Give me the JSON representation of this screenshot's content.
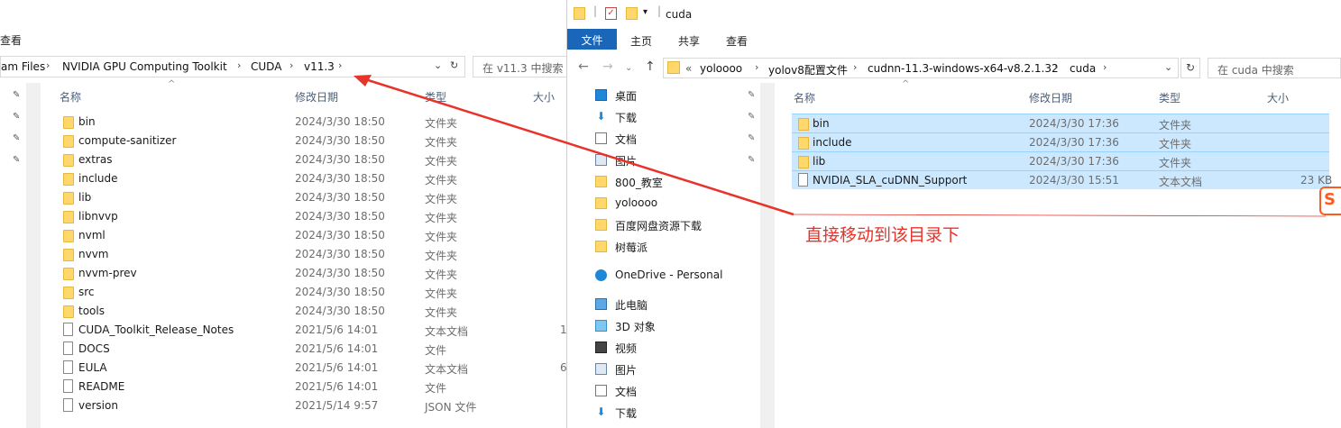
{
  "left": {
    "menu_fragment": "查看",
    "breadcrumb": [
      "am Files",
      "NVIDIA GPU Computing Toolkit",
      "CUDA",
      "v11.3"
    ],
    "search_placeholder": "在 v11.3 中搜索",
    "columns": {
      "name": "名称",
      "date": "修改日期",
      "type": "类型",
      "size": "大小"
    },
    "rows": [
      {
        "icon": "folder",
        "name": "bin",
        "date": "2024/3/30 18:50",
        "type": "文件夹",
        "size": ""
      },
      {
        "icon": "folder",
        "name": "compute-sanitizer",
        "date": "2024/3/30 18:50",
        "type": "文件夹",
        "size": ""
      },
      {
        "icon": "folder",
        "name": "extras",
        "date": "2024/3/30 18:50",
        "type": "文件夹",
        "size": ""
      },
      {
        "icon": "folder",
        "name": "include",
        "date": "2024/3/30 18:50",
        "type": "文件夹",
        "size": ""
      },
      {
        "icon": "folder",
        "name": "lib",
        "date": "2024/3/30 18:50",
        "type": "文件夹",
        "size": ""
      },
      {
        "icon": "folder",
        "name": "libnvvp",
        "date": "2024/3/30 18:50",
        "type": "文件夹",
        "size": ""
      },
      {
        "icon": "folder",
        "name": "nvml",
        "date": "2024/3/30 18:50",
        "type": "文件夹",
        "size": ""
      },
      {
        "icon": "folder",
        "name": "nvvm",
        "date": "2024/3/30 18:50",
        "type": "文件夹",
        "size": ""
      },
      {
        "icon": "folder",
        "name": "nvvm-prev",
        "date": "2024/3/30 18:50",
        "type": "文件夹",
        "size": ""
      },
      {
        "icon": "folder",
        "name": "src",
        "date": "2024/3/30 18:50",
        "type": "文件夹",
        "size": ""
      },
      {
        "icon": "folder",
        "name": "tools",
        "date": "2024/3/30 18:50",
        "type": "文件夹",
        "size": ""
      },
      {
        "icon": "doc",
        "name": "CUDA_Toolkit_Release_Notes",
        "date": "2021/5/6 14:01",
        "type": "文本文档",
        "size": "1"
      },
      {
        "icon": "doc",
        "name": "DOCS",
        "date": "2021/5/6 14:01",
        "type": "文件",
        "size": ""
      },
      {
        "icon": "doc",
        "name": "EULA",
        "date": "2021/5/6 14:01",
        "type": "文本文档",
        "size": "6"
      },
      {
        "icon": "doc",
        "name": "README",
        "date": "2021/5/6 14:01",
        "type": "文件",
        "size": ""
      },
      {
        "icon": "doc",
        "name": "version",
        "date": "2021/5/14 9:57",
        "type": "JSON 文件",
        "size": ""
      }
    ]
  },
  "right": {
    "title": "cuda",
    "ribbon": {
      "file": "文件",
      "home": "主页",
      "share": "共享",
      "view": "查看"
    },
    "breadcrumb": [
      "«",
      "yoloooo",
      "yolov8配置文件",
      "cudnn-11.3-windows-x64-v8.2.1.32",
      "cuda"
    ],
    "search_placeholder": "在 cuda 中搜索",
    "tree": [
      {
        "icon": "desktop-icon",
        "label": "桌面"
      },
      {
        "icon": "download-icon",
        "label": "下载"
      },
      {
        "icon": "document-icon",
        "label": "文档"
      },
      {
        "icon": "picture-icon",
        "label": "图片"
      },
      {
        "icon": "folder-icon",
        "label": "800_教室"
      },
      {
        "icon": "folder-icon",
        "label": "yoloooo"
      },
      {
        "icon": "folder-icon",
        "label": "百度网盘资源下载"
      },
      {
        "icon": "folder-icon",
        "label": "树莓派"
      },
      {
        "icon": "onedrive-icon",
        "label": "OneDrive - Personal"
      },
      {
        "icon": "pc-icon",
        "label": "此电脑"
      },
      {
        "icon": "3d-icon",
        "label": "3D 对象"
      },
      {
        "icon": "video-icon",
        "label": "视频"
      },
      {
        "icon": "picture-icon",
        "label": "图片"
      },
      {
        "icon": "document-icon",
        "label": "文档"
      },
      {
        "icon": "download-icon",
        "label": "下载"
      }
    ],
    "columns": {
      "name": "名称",
      "date": "修改日期",
      "type": "类型",
      "size": "大小"
    },
    "rows": [
      {
        "icon": "folder",
        "name": "bin",
        "date": "2024/3/30 17:36",
        "type": "文件夹",
        "size": ""
      },
      {
        "icon": "folder",
        "name": "include",
        "date": "2024/3/30 17:36",
        "type": "文件夹",
        "size": ""
      },
      {
        "icon": "folder",
        "name": "lib",
        "date": "2024/3/30 17:36",
        "type": "文件夹",
        "size": ""
      },
      {
        "icon": "doc",
        "name": "NVIDIA_SLA_cuDNN_Support",
        "date": "2024/3/30 15:51",
        "type": "文本文档",
        "size": "23 KB"
      }
    ]
  },
  "annotation": {
    "text": "直接移动到该目录下",
    "color": "#e8332b"
  },
  "ime_badge": "S"
}
